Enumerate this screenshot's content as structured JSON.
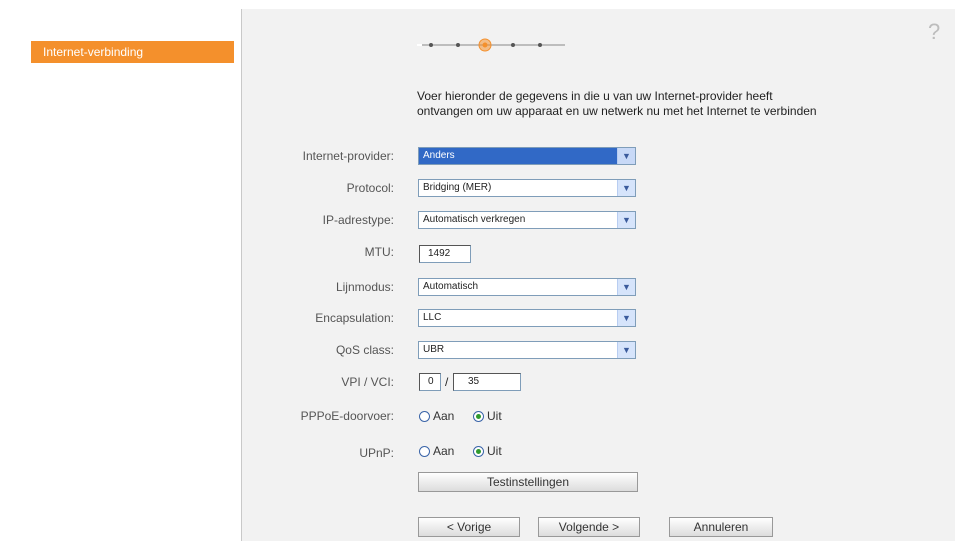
{
  "sidebar": {
    "active_item": "Internet-verbinding"
  },
  "help": {
    "icon": "?"
  },
  "intro": "Voer hieronder de gegevens in die u van uw Internet-provider heeft ontvangen om uw apparaat en uw netwerk nu met het Internet te verbinden",
  "form": {
    "provider": {
      "label": "Internet-provider:",
      "value": "Anders"
    },
    "protocol": {
      "label": "Protocol:",
      "value": "Bridging (MER)"
    },
    "ip_type": {
      "label": "IP-adrestype:",
      "value": "Automatisch verkregen"
    },
    "mtu": {
      "label": "MTU:",
      "value": "1492"
    },
    "line_mode": {
      "label": "Lijnmodus:",
      "value": "Automatisch"
    },
    "encapsulation": {
      "label": "Encapsulation:",
      "value": "LLC"
    },
    "qos": {
      "label": "QoS class:",
      "value": "UBR"
    },
    "vpi_vci": {
      "label": "VPI / VCI:",
      "vpi": "0",
      "separator": "/",
      "vci": "35"
    },
    "pppoe": {
      "label": "PPPoE-doorvoer:",
      "option_on": "Aan",
      "option_off": "Uit",
      "selected": "Uit"
    },
    "upnp": {
      "label": "UPnP:",
      "option_on": "Aan",
      "option_off": "Uit",
      "selected": "Uit"
    }
  },
  "buttons": {
    "test": "Testinstellingen",
    "previous": "< Vorige",
    "next": "Volgende >",
    "cancel": "Annuleren"
  },
  "wizard": {
    "steps": 5,
    "current_step": 3
  },
  "colors": {
    "accent": "#f4902c",
    "panel_bg": "#f2f2f2",
    "selected_bg": "#3169c6"
  }
}
